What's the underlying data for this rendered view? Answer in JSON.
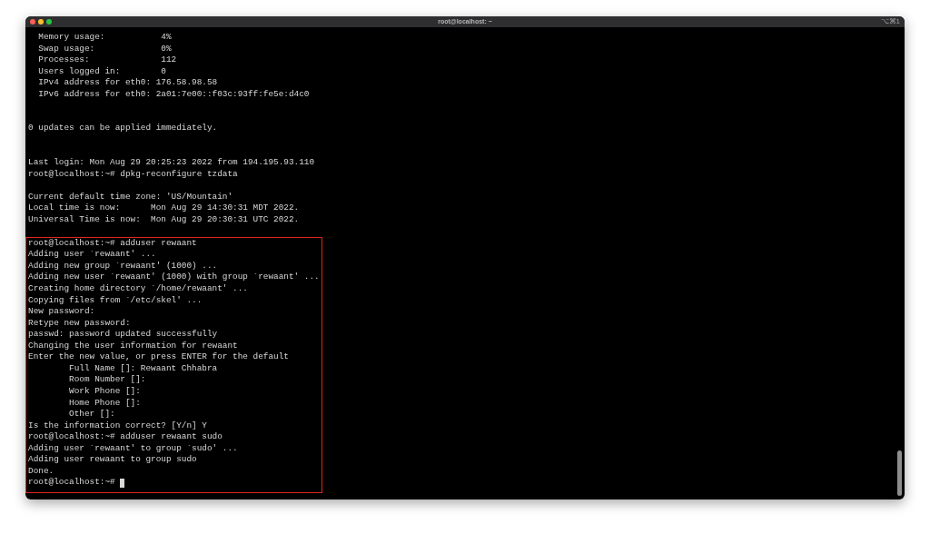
{
  "window": {
    "title": "root@localhost: ~",
    "shortcut": "⌥⌘1"
  },
  "terminal": {
    "blocks": [
      {
        "kind": "plain",
        "lines": [
          {
            "kind": "text",
            "text": "  Memory usage:           4%"
          },
          {
            "kind": "text",
            "text": "  Swap usage:             0%"
          },
          {
            "kind": "text",
            "text": "  Processes:              112"
          },
          {
            "kind": "text",
            "text": "  Users logged in:        0"
          },
          {
            "kind": "text",
            "text": "  IPv4 address for eth0: 176.58.98.58"
          },
          {
            "kind": "text",
            "text": "  IPv6 address for eth0: 2a01:7e00::f03c:93ff:fe5e:d4c0"
          },
          {
            "kind": "blank"
          },
          {
            "kind": "blank"
          },
          {
            "kind": "text",
            "text": "0 updates can be applied immediately."
          },
          {
            "kind": "blank"
          },
          {
            "kind": "blank"
          },
          {
            "kind": "text",
            "text": "Last login: Mon Aug 29 20:25:23 2022 from 194.195.93.110"
          },
          {
            "kind": "text",
            "text": "root@localhost:~# dpkg-reconfigure tzdata"
          },
          {
            "kind": "blank"
          },
          {
            "kind": "text",
            "text": "Current default time zone: 'US/Mountain'"
          },
          {
            "kind": "text",
            "text": "Local time is now:      Mon Aug 29 14:30:31 MDT 2022."
          },
          {
            "kind": "text",
            "text": "Universal Time is now:  Mon Aug 29 20:30:31 UTC 2022."
          },
          {
            "kind": "blank"
          }
        ]
      },
      {
        "kind": "highlighted",
        "cursor": true,
        "lines": [
          {
            "kind": "text",
            "text": "root@localhost:~# adduser rewaant"
          },
          {
            "kind": "text",
            "text": "Adding user `rewaant' ..."
          },
          {
            "kind": "text",
            "text": "Adding new group `rewaant' (1000) ..."
          },
          {
            "kind": "text",
            "text": "Adding new user `rewaant' (1000) with group `rewaant' ..."
          },
          {
            "kind": "text",
            "text": "Creating home directory `/home/rewaant' ..."
          },
          {
            "kind": "text",
            "text": "Copying files from `/etc/skel' ..."
          },
          {
            "kind": "text",
            "text": "New password:"
          },
          {
            "kind": "text",
            "text": "Retype new password:"
          },
          {
            "kind": "text",
            "text": "passwd: password updated successfully"
          },
          {
            "kind": "text",
            "text": "Changing the user information for rewaant"
          },
          {
            "kind": "text",
            "text": "Enter the new value, or press ENTER for the default"
          },
          {
            "kind": "text",
            "text": "        Full Name []: Rewaant Chhabra"
          },
          {
            "kind": "text",
            "text": "        Room Number []:"
          },
          {
            "kind": "text",
            "text": "        Work Phone []:"
          },
          {
            "kind": "text",
            "text": "        Home Phone []:"
          },
          {
            "kind": "text",
            "text": "        Other []:"
          },
          {
            "kind": "text",
            "text": "Is the information correct? [Y/n] Y"
          },
          {
            "kind": "text",
            "text": "root@localhost:~# adduser rewaant sudo"
          },
          {
            "kind": "text",
            "text": "Adding user `rewaant' to group `sudo' ..."
          },
          {
            "kind": "text",
            "text": "Adding user rewaant to group sudo"
          },
          {
            "kind": "text",
            "text": "Done."
          },
          {
            "kind": "text",
            "text": "root@localhost:~#"
          }
        ]
      }
    ]
  }
}
